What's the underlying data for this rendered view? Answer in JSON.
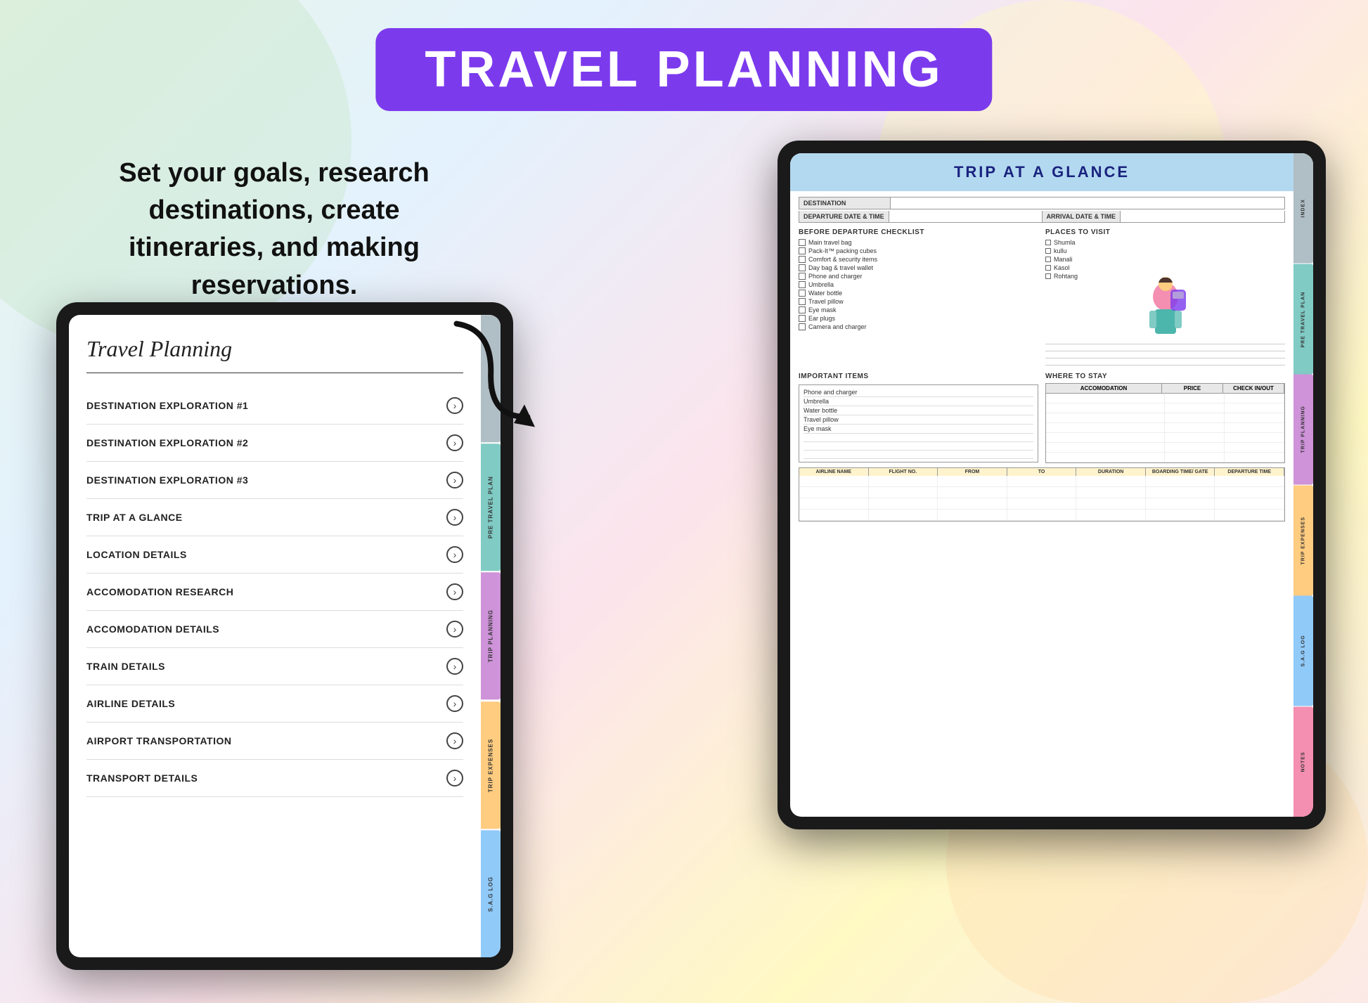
{
  "background": {
    "color": "#f0f9f0"
  },
  "header": {
    "title": "TRAVEL PLANNING",
    "badge_bg": "#7c3aed"
  },
  "tagline": {
    "text": "Set your goals, research destinations, create itineraries, and making reservations."
  },
  "left_tablet": {
    "screen_title": "Travel Planning",
    "menu_items": [
      "DESTINATION EXPLORATION #1",
      "DESTINATION EXPLORATION #2",
      "DESTINATION EXPLORATION #3",
      "TRIP AT A GLANCE",
      "LOCATION DETAILS",
      "ACCOMODATION RESEARCH",
      "ACCOMODATION DETAILS",
      "TRAIN DETAILS",
      "AIRLINE DETAILS",
      "AIRPORT TRANSPORTATION",
      "TRANSPORT DETAILS"
    ],
    "tabs": [
      {
        "label": "INDEX",
        "class": "tab-index"
      },
      {
        "label": "PRE TRAVEL PLAN",
        "class": "tab-pre"
      },
      {
        "label": "TRIP PLANNING",
        "class": "tab-trip"
      },
      {
        "label": "TRIP EXPENSES",
        "class": "tab-expenses"
      },
      {
        "label": "S.A.G LOG",
        "class": "tab-sag"
      }
    ]
  },
  "right_tablet": {
    "page_title": "TRIP AT A GLANCE",
    "fields": {
      "destination_label": "DESTINATION",
      "departure_label": "DEPARTURE DATE & TIME",
      "arrival_label": "ARRIVAL DATE & TIME"
    },
    "before_departure": {
      "title": "BEFORE DEPARTURE CHECKLIST",
      "items": [
        {
          "text": "Main travel bag",
          "strikethrough": false
        },
        {
          "text": "Pack-It™ packing cubes",
          "strikethrough": false
        },
        {
          "text": "Comfort & security items",
          "strikethrough": false
        },
        {
          "text": "Day bag & travel wallet",
          "strikethrough": false
        },
        {
          "text": "Phone and charger",
          "strikethrough": false
        },
        {
          "text": "Umbrella",
          "strikethrough": false
        },
        {
          "text": "Water bottle",
          "strikethrough": false
        },
        {
          "text": "Travel pillow",
          "strikethrough": false
        },
        {
          "text": "Eye mask",
          "strikethrough": false
        },
        {
          "text": "Ear plugs",
          "strikethrough": false
        },
        {
          "text": "Camera and charger",
          "strikethrough": false
        }
      ]
    },
    "places_to_visit": {
      "title": "PLACES TO VISIT",
      "items": [
        "Shumla",
        "kullu",
        "Manali",
        "Kasol",
        "Rohtang"
      ]
    },
    "important_items": {
      "title": "IMPORTANT ITEMS",
      "items": [
        "Phone and charger",
        "Umbrella",
        "Water bottle",
        "Travel pillow",
        "Eye mask"
      ]
    },
    "where_to_stay": {
      "title": "WHERE TO STAY",
      "headers": [
        "ACCOMODATION",
        "PRICE",
        "CHECK IN/OUT"
      ]
    },
    "flight_table": {
      "headers": [
        "AIRLINE NAME",
        "FLIGHT NO.",
        "FROM",
        "TO",
        "DURATION",
        "BOARDING TIME/ GATE",
        "DEPARTURE TIME"
      ]
    },
    "tabs": [
      {
        "label": "INDEX",
        "class": "rtab-index"
      },
      {
        "label": "PRE TRAVEL PLAN",
        "class": "rtab-pre"
      },
      {
        "label": "TRIP PLANNING",
        "class": "rtab-trip"
      },
      {
        "label": "TRIP EXPENSES",
        "class": "rtab-expenses"
      },
      {
        "label": "S.A.G LOG",
        "class": "rtab-sag"
      },
      {
        "label": "NOTES",
        "class": "rtab-notes"
      }
    ]
  }
}
